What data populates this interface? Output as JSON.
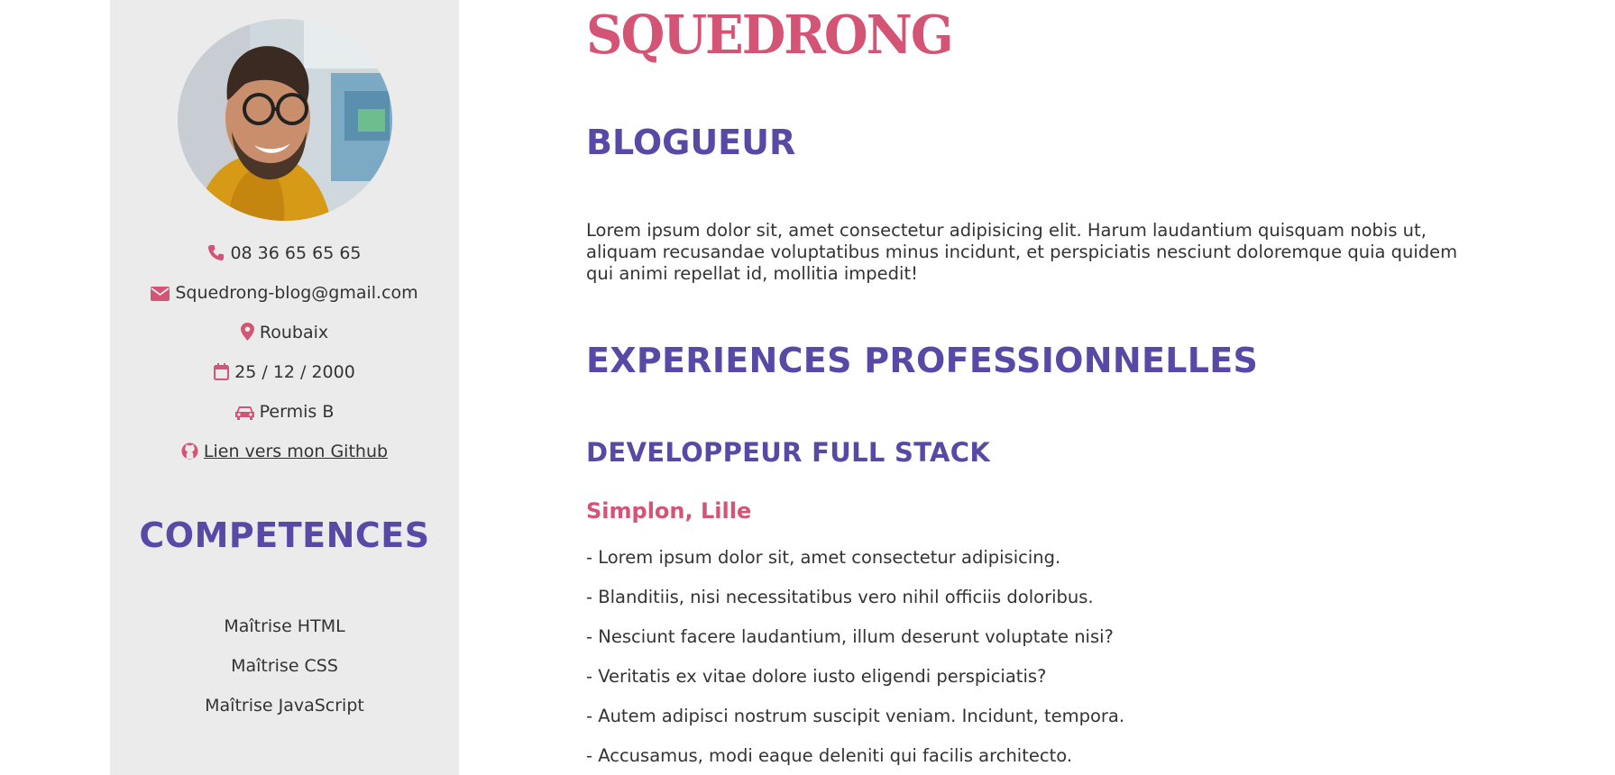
{
  "sidebar": {
    "contact": [
      {
        "icon": "phone-icon",
        "text": "08 36 65 65 65"
      },
      {
        "icon": "envelope-icon",
        "text": "Squedrong-blog@gmail.com"
      },
      {
        "icon": "map-marker-icon",
        "text": "Roubaix"
      },
      {
        "icon": "calendar-icon",
        "text": "25 / 12 / 2000"
      },
      {
        "icon": "car-icon",
        "text": "Permis B"
      },
      {
        "icon": "github-icon",
        "text": "Lien vers mon Github"
      }
    ],
    "competences_title": "COMPETENCES",
    "skills": [
      "Maîtrise HTML",
      "Maîtrise CSS",
      "Maîtrise JavaScript"
    ]
  },
  "main": {
    "brand": "SQUEDRONG",
    "job_title": "BLOGUEUR",
    "intro": "Lorem ipsum dolor sit, amet consectetur adipisicing elit. Harum laudantium quisquam nobis ut, aliquam recusandae voluptatibus minus incidunt, et perspiciatis nesciunt doloremque quia quidem qui animi repellat id, mollitia impedit!",
    "experiences_title": "EXPERIENCES PROFESSIONNELLES",
    "experience": {
      "title": "DEVELOPPEUR FULL STACK",
      "company": "Simplon, Lille",
      "bullets": [
        "- Lorem ipsum dolor sit, amet consectetur adipisicing.",
        "- Blanditiis, nisi necessitatibus vero nihil officiis doloribus.",
        "- Nesciunt facere laudantium, illum deserunt voluptate nisi?",
        "- Veritatis ex vitae dolore iusto eligendi perspiciatis?",
        "- Autem adipisci nostrum suscipit veniam. Incidunt, tempora.",
        "- Accusamus, modi eaque deleniti qui facilis architecto."
      ]
    }
  },
  "colors": {
    "accent_pink": "#d35474",
    "accent_purple": "#5849a6",
    "sidebar_bg": "#ebebeb",
    "text": "#333333"
  }
}
